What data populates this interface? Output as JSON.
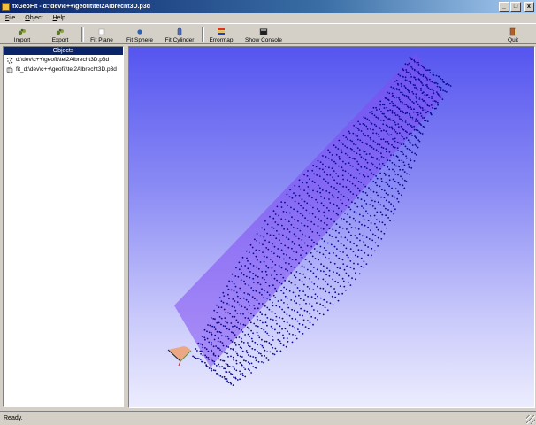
{
  "window": {
    "title": "fxGeoFit - d:\\dev\\c++\\geofit\\tel2Albrecht3D.p3d",
    "minimize_label": "_",
    "maximize_label": "□",
    "close_label": "x"
  },
  "menu": {
    "items": [
      {
        "mnemonic": "F",
        "rest": "ile"
      },
      {
        "mnemonic": "O",
        "rest": "bject"
      },
      {
        "mnemonic": "H",
        "rest": "elp"
      }
    ]
  },
  "toolbar": {
    "import_label": "Import",
    "export_label": "Export",
    "fit_plane_label": "Fit Plane",
    "fit_sphere_label": "Fit Sphere",
    "fit_cylinder_label": "Fit Cylinder",
    "errormap_label": "Errormap",
    "show_console_label": "Show Console",
    "quit_label": "Quit"
  },
  "objects_panel": {
    "header": "Objects",
    "items": [
      {
        "label": "d:\\dev\\c++\\geofit\\tel2Albrecht3D.p3d",
        "icon": "point-cloud-icon"
      },
      {
        "label": "fit_d:\\dev\\c++\\geofit\\tel2Albrecht3D.p3d",
        "icon": "mesh-icon"
      }
    ]
  },
  "viewport": {
    "point_color": "#0a0a90",
    "plane_color": "#7f4cf2",
    "background_top": "#5555f0",
    "background_bottom": "#ececfe"
  },
  "status": {
    "text": "Ready."
  }
}
